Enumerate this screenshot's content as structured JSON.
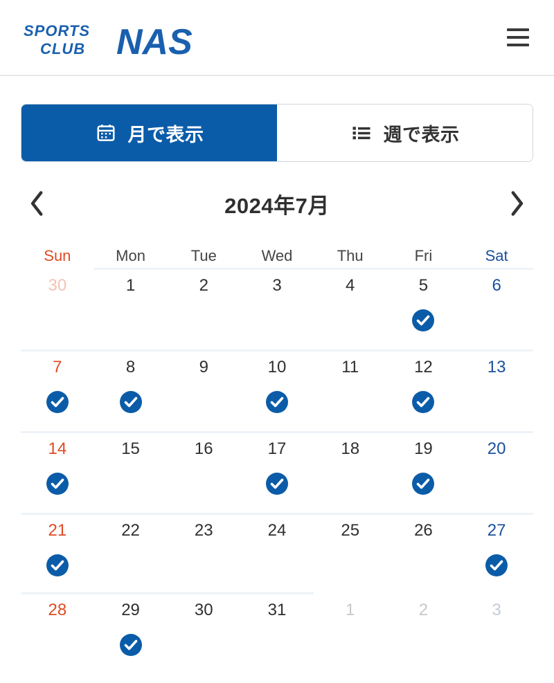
{
  "header": {
    "logo_top_text": "SPORTS",
    "logo_bottom_text": "CLUB",
    "logo_brand_text": "NAS",
    "logo_color": "#1960ae",
    "menu_icon": "hamburger-menu-icon"
  },
  "view_tabs": [
    {
      "label": "月で表示",
      "icon": "calendar-icon",
      "active": true
    },
    {
      "label": "週で表示",
      "icon": "list-icon",
      "active": false
    }
  ],
  "month_nav": {
    "prev_icon": "chevron-left-icon",
    "next_icon": "chevron-right-icon",
    "title": "2024年7月"
  },
  "calendar": {
    "day_headers": [
      "Sun",
      "Mon",
      "Tue",
      "Wed",
      "Thu",
      "Fri",
      "Sat"
    ],
    "accent_color": "#0b5ca8",
    "sunday_color": "#e04a23",
    "saturday_color": "#1a4f9c",
    "check_icon": "check-circle-icon",
    "weeks": [
      [
        {
          "num": "30",
          "current": false,
          "checked": false
        },
        {
          "num": "1",
          "current": true,
          "checked": false
        },
        {
          "num": "2",
          "current": true,
          "checked": false
        },
        {
          "num": "3",
          "current": true,
          "checked": false
        },
        {
          "num": "4",
          "current": true,
          "checked": false
        },
        {
          "num": "5",
          "current": true,
          "checked": true
        },
        {
          "num": "6",
          "current": true,
          "checked": false
        }
      ],
      [
        {
          "num": "7",
          "current": true,
          "checked": true
        },
        {
          "num": "8",
          "current": true,
          "checked": true
        },
        {
          "num": "9",
          "current": true,
          "checked": false
        },
        {
          "num": "10",
          "current": true,
          "checked": true
        },
        {
          "num": "11",
          "current": true,
          "checked": false
        },
        {
          "num": "12",
          "current": true,
          "checked": true
        },
        {
          "num": "13",
          "current": true,
          "checked": false
        }
      ],
      [
        {
          "num": "14",
          "current": true,
          "checked": true
        },
        {
          "num": "15",
          "current": true,
          "checked": false
        },
        {
          "num": "16",
          "current": true,
          "checked": false
        },
        {
          "num": "17",
          "current": true,
          "checked": true
        },
        {
          "num": "18",
          "current": true,
          "checked": false
        },
        {
          "num": "19",
          "current": true,
          "checked": true
        },
        {
          "num": "20",
          "current": true,
          "checked": false
        }
      ],
      [
        {
          "num": "21",
          "current": true,
          "checked": true
        },
        {
          "num": "22",
          "current": true,
          "checked": false
        },
        {
          "num": "23",
          "current": true,
          "checked": false
        },
        {
          "num": "24",
          "current": true,
          "checked": false
        },
        {
          "num": "25",
          "current": true,
          "checked": false
        },
        {
          "num": "26",
          "current": true,
          "checked": false
        },
        {
          "num": "27",
          "current": true,
          "checked": true
        }
      ],
      [
        {
          "num": "28",
          "current": true,
          "checked": false
        },
        {
          "num": "29",
          "current": true,
          "checked": true
        },
        {
          "num": "30",
          "current": true,
          "checked": false
        },
        {
          "num": "31",
          "current": true,
          "checked": false
        },
        {
          "num": "1",
          "current": false,
          "checked": false
        },
        {
          "num": "2",
          "current": false,
          "checked": false
        },
        {
          "num": "3",
          "current": false,
          "checked": false
        }
      ]
    ]
  }
}
